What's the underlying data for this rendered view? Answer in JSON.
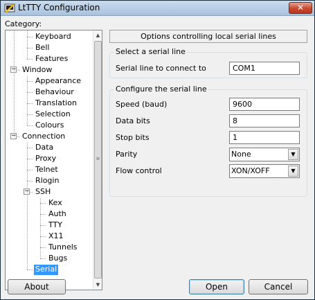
{
  "window": {
    "title": "LtTTY Configuration",
    "close_glyph": "✕"
  },
  "category_label": "Category:",
  "tree": [
    {
      "label": "Keyboard",
      "depth": 2
    },
    {
      "label": "Bell",
      "depth": 2
    },
    {
      "label": "Features",
      "depth": 2
    },
    {
      "label": "Window",
      "depth": 1,
      "expander": "−"
    },
    {
      "label": "Appearance",
      "depth": 2
    },
    {
      "label": "Behaviour",
      "depth": 2
    },
    {
      "label": "Translation",
      "depth": 2
    },
    {
      "label": "Selection",
      "depth": 2
    },
    {
      "label": "Colours",
      "depth": 2
    },
    {
      "label": "Connection",
      "depth": 1,
      "expander": "−"
    },
    {
      "label": "Data",
      "depth": 2
    },
    {
      "label": "Proxy",
      "depth": 2
    },
    {
      "label": "Telnet",
      "depth": 2
    },
    {
      "label": "Rlogin",
      "depth": 2
    },
    {
      "label": "SSH",
      "depth": 2,
      "expander": "−"
    },
    {
      "label": "Kex",
      "depth": 3
    },
    {
      "label": "Auth",
      "depth": 3
    },
    {
      "label": "TTY",
      "depth": 3
    },
    {
      "label": "X11",
      "depth": 3
    },
    {
      "label": "Tunnels",
      "depth": 3
    },
    {
      "label": "Bugs",
      "depth": 3
    },
    {
      "label": "Serial",
      "depth": 2,
      "selected": true
    }
  ],
  "scrollbar": {
    "up_glyph": "▲",
    "down_glyph": "▼",
    "grip_glyph": "≡"
  },
  "panel": {
    "title": "Options controlling local serial lines",
    "select_group": {
      "label": "Select a serial line",
      "line_label": "Serial line to connect to",
      "line_value": "COM1"
    },
    "config_group": {
      "label": "Configure the serial line",
      "speed_label": "Speed (baud)",
      "speed_value": "9600",
      "databits_label": "Data bits",
      "databits_value": "8",
      "stopbits_label": "Stop bits",
      "stopbits_value": "1",
      "parity_label": "Parity",
      "parity_value": "None",
      "flow_label": "Flow control",
      "flow_value": "XON/XOFF",
      "dropdown_glyph": "▼"
    }
  },
  "buttons": {
    "about": "About",
    "open": "Open",
    "cancel": "Cancel"
  }
}
